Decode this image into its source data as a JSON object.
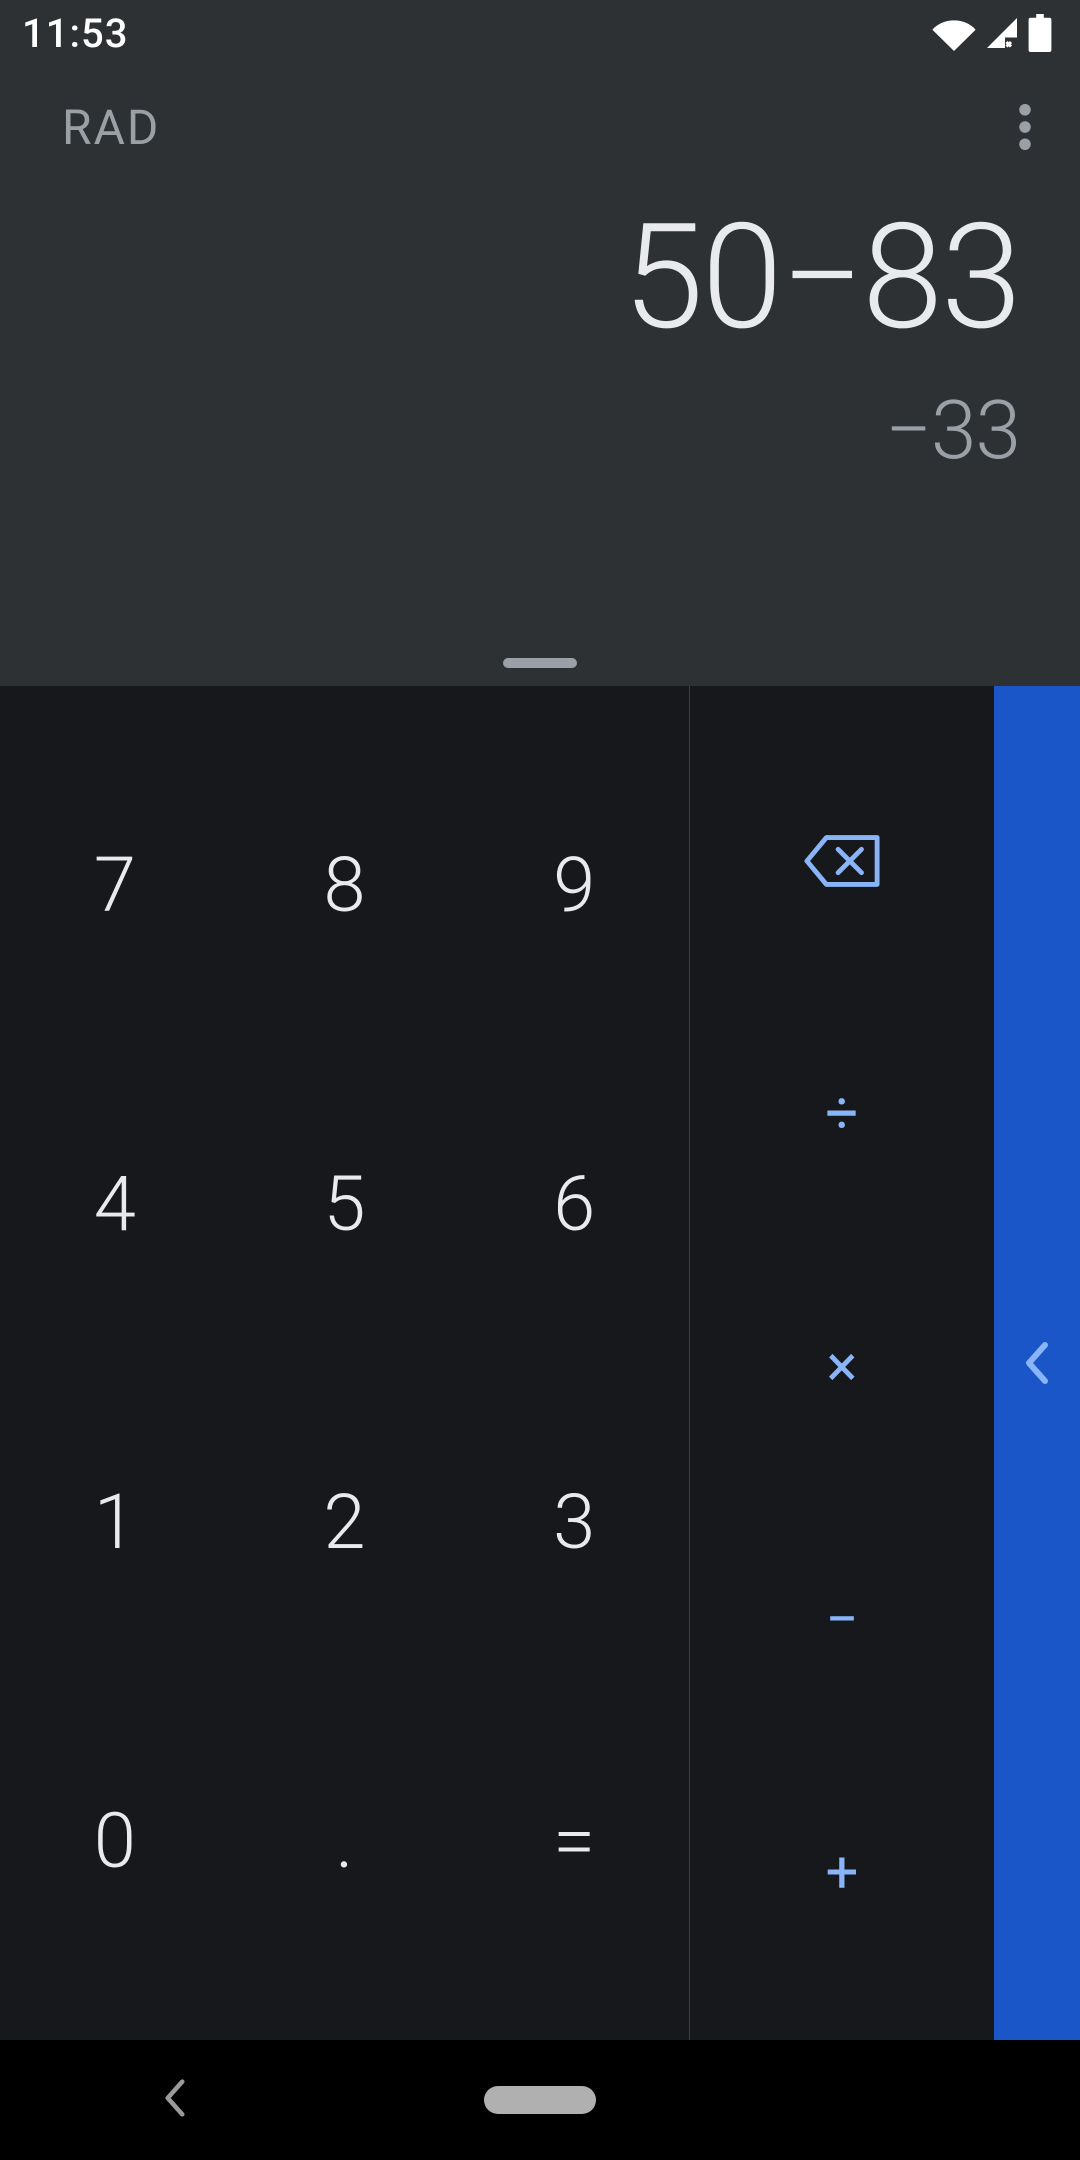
{
  "status": {
    "time": "11:53"
  },
  "display": {
    "angle_mode": "RAD",
    "expression": "50−83",
    "result": "−33"
  },
  "keys": {
    "d7": "7",
    "d8": "8",
    "d9": "9",
    "d4": "4",
    "d5": "5",
    "d6": "6",
    "d1": "1",
    "d2": "2",
    "d3": "3",
    "d0": "0",
    "dot": ".",
    "eq": "=",
    "div": "÷",
    "mul": "×",
    "sub": "−",
    "add": "+"
  }
}
